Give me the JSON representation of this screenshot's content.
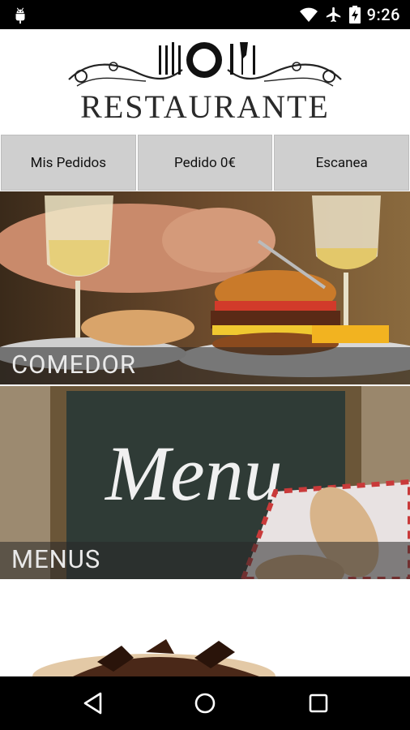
{
  "status_bar": {
    "time": "9:26",
    "icons": [
      "android-icon",
      "wifi-icon",
      "airplane-mode-icon",
      "battery-charging-icon"
    ]
  },
  "header": {
    "logo_text": "RESTAURANTE"
  },
  "top_buttons": [
    {
      "label": "Mis Pedidos"
    },
    {
      "label": "Pedido 0€"
    },
    {
      "label": "Escanea"
    }
  ],
  "categories": [
    {
      "label": "COMEDOR"
    },
    {
      "label": "MENUS"
    },
    {
      "label": ""
    }
  ],
  "nav": {
    "icons": [
      "back-icon",
      "home-icon",
      "recents-icon"
    ]
  }
}
